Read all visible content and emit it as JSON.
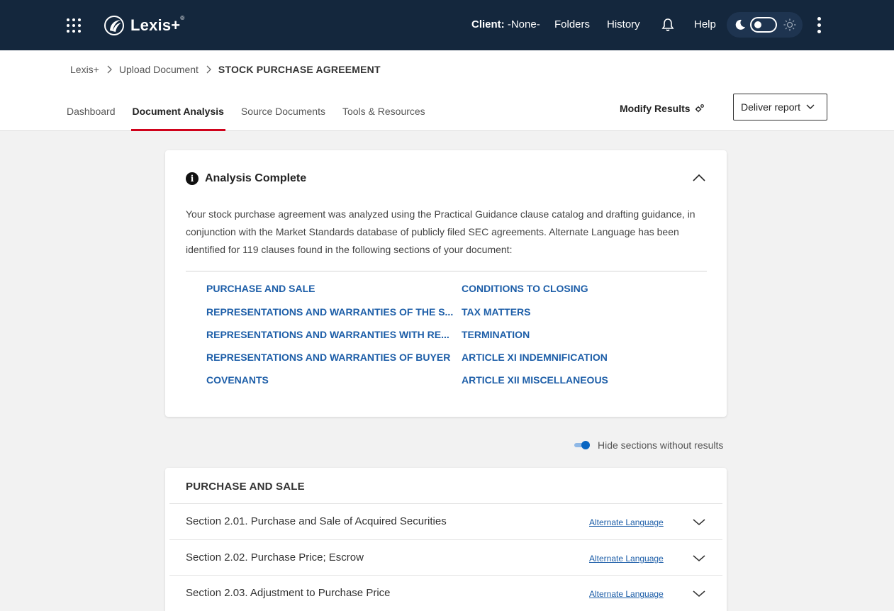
{
  "topbar": {
    "brand": "Lexis+",
    "brand_mark": "®",
    "client_label": "Client:",
    "client_value": "-None-",
    "folders": "Folders",
    "history": "History",
    "help": "Help",
    "bg_color": "#14273d"
  },
  "breadcrumb": [
    "Lexis+",
    "Upload Document",
    "STOCK PURCHASE AGREEMENT"
  ],
  "tabs": [
    {
      "label": "Dashboard",
      "active": false
    },
    {
      "label": "Document Analysis",
      "active": true
    },
    {
      "label": "Source Documents",
      "active": false
    },
    {
      "label": "Tools & Resources",
      "active": false
    }
  ],
  "actions": {
    "modify_results": "Modify Results",
    "deliver_report": "Deliver report"
  },
  "analysis": {
    "title": "Analysis Complete",
    "summary": "Your stock purchase agreement was analyzed using the Practical Guidance clause catalog and drafting guidance, in conjunction with the Market Standards database of publicly filed SEC agreements. Alternate Language has been identified for 119 clauses found in the following sections of your document:",
    "sections_left": [
      "PURCHASE AND SALE",
      "REPRESENTATIONS AND WARRANTIES OF THE S...",
      "REPRESENTATIONS AND WARRANTIES WITH RE...",
      "REPRESENTATIONS AND WARRANTIES OF BUYER",
      "COVENANTS"
    ],
    "sections_right": [
      "CONDITIONS TO CLOSING",
      "TAX MATTERS",
      "TERMINATION",
      "ARTICLE XI INDEMNIFICATION",
      "ARTICLE XII MISCELLANEOUS"
    ]
  },
  "filter": {
    "hide_label": "Hide sections without results",
    "hide_enabled": true
  },
  "results": {
    "heading": "PURCHASE AND SALE",
    "rows": [
      {
        "title": "Section 2.01. Purchase and Sale of Acquired Securities",
        "link": "Alternate Language"
      },
      {
        "title": "Section 2.02. Purchase Price; Escrow",
        "link": "Alternate Language"
      },
      {
        "title": "Section 2.03. Adjustment to Purchase Price",
        "link": "Alternate Language"
      }
    ]
  },
  "colors": {
    "accent_red": "#d0021b",
    "link_blue": "#1d5ea8",
    "toggle_blue": "#0a66c2"
  },
  "icons": [
    "apps-grid-icon",
    "lexis-logo-icon",
    "bell-icon",
    "moon-icon",
    "sun-icon",
    "kebab-menu-icon",
    "chevron-right-icon",
    "gear-icon",
    "chevron-down-icon",
    "chevron-up-icon",
    "info-icon"
  ]
}
